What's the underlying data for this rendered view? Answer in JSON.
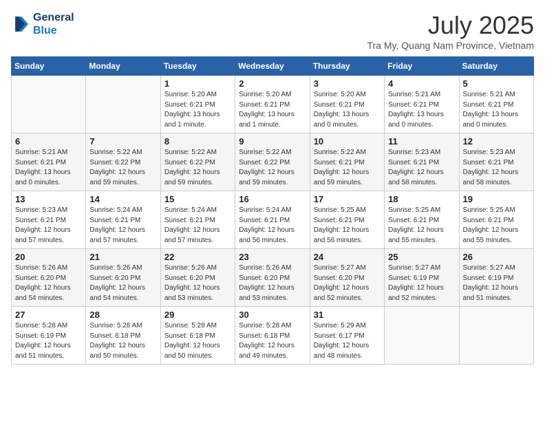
{
  "header": {
    "logo_line1": "General",
    "logo_line2": "Blue",
    "month_year": "July 2025",
    "location": "Tra My, Quang Nam Province, Vietnam"
  },
  "weekdays": [
    "Sunday",
    "Monday",
    "Tuesday",
    "Wednesday",
    "Thursday",
    "Friday",
    "Saturday"
  ],
  "weeks": [
    [
      {
        "day": "",
        "info": ""
      },
      {
        "day": "",
        "info": ""
      },
      {
        "day": "1",
        "info": "Sunrise: 5:20 AM\nSunset: 6:21 PM\nDaylight: 13 hours and 1 minute."
      },
      {
        "day": "2",
        "info": "Sunrise: 5:20 AM\nSunset: 6:21 PM\nDaylight: 13 hours and 1 minute."
      },
      {
        "day": "3",
        "info": "Sunrise: 5:20 AM\nSunset: 6:21 PM\nDaylight: 13 hours and 0 minutes."
      },
      {
        "day": "4",
        "info": "Sunrise: 5:21 AM\nSunset: 6:21 PM\nDaylight: 13 hours and 0 minutes."
      },
      {
        "day": "5",
        "info": "Sunrise: 5:21 AM\nSunset: 6:21 PM\nDaylight: 13 hours and 0 minutes."
      }
    ],
    [
      {
        "day": "6",
        "info": "Sunrise: 5:21 AM\nSunset: 6:21 PM\nDaylight: 13 hours and 0 minutes."
      },
      {
        "day": "7",
        "info": "Sunrise: 5:22 AM\nSunset: 6:22 PM\nDaylight: 12 hours and 59 minutes."
      },
      {
        "day": "8",
        "info": "Sunrise: 5:22 AM\nSunset: 6:22 PM\nDaylight: 12 hours and 59 minutes."
      },
      {
        "day": "9",
        "info": "Sunrise: 5:22 AM\nSunset: 6:22 PM\nDaylight: 12 hours and 59 minutes."
      },
      {
        "day": "10",
        "info": "Sunrise: 5:22 AM\nSunset: 6:21 PM\nDaylight: 12 hours and 59 minutes."
      },
      {
        "day": "11",
        "info": "Sunrise: 5:23 AM\nSunset: 6:21 PM\nDaylight: 12 hours and 58 minutes."
      },
      {
        "day": "12",
        "info": "Sunrise: 5:23 AM\nSunset: 6:21 PM\nDaylight: 12 hours and 58 minutes."
      }
    ],
    [
      {
        "day": "13",
        "info": "Sunrise: 5:23 AM\nSunset: 6:21 PM\nDaylight: 12 hours and 57 minutes."
      },
      {
        "day": "14",
        "info": "Sunrise: 5:24 AM\nSunset: 6:21 PM\nDaylight: 12 hours and 57 minutes."
      },
      {
        "day": "15",
        "info": "Sunrise: 5:24 AM\nSunset: 6:21 PM\nDaylight: 12 hours and 57 minutes."
      },
      {
        "day": "16",
        "info": "Sunrise: 5:24 AM\nSunset: 6:21 PM\nDaylight: 12 hours and 56 minutes."
      },
      {
        "day": "17",
        "info": "Sunrise: 5:25 AM\nSunset: 6:21 PM\nDaylight: 12 hours and 56 minutes."
      },
      {
        "day": "18",
        "info": "Sunrise: 5:25 AM\nSunset: 6:21 PM\nDaylight: 12 hours and 55 minutes."
      },
      {
        "day": "19",
        "info": "Sunrise: 5:25 AM\nSunset: 6:21 PM\nDaylight: 12 hours and 55 minutes."
      }
    ],
    [
      {
        "day": "20",
        "info": "Sunrise: 5:26 AM\nSunset: 6:20 PM\nDaylight: 12 hours and 54 minutes."
      },
      {
        "day": "21",
        "info": "Sunrise: 5:26 AM\nSunset: 6:20 PM\nDaylight: 12 hours and 54 minutes."
      },
      {
        "day": "22",
        "info": "Sunrise: 5:26 AM\nSunset: 6:20 PM\nDaylight: 12 hours and 53 minutes."
      },
      {
        "day": "23",
        "info": "Sunrise: 5:26 AM\nSunset: 6:20 PM\nDaylight: 12 hours and 53 minutes."
      },
      {
        "day": "24",
        "info": "Sunrise: 5:27 AM\nSunset: 6:20 PM\nDaylight: 12 hours and 52 minutes."
      },
      {
        "day": "25",
        "info": "Sunrise: 5:27 AM\nSunset: 6:19 PM\nDaylight: 12 hours and 52 minutes."
      },
      {
        "day": "26",
        "info": "Sunrise: 5:27 AM\nSunset: 6:19 PM\nDaylight: 12 hours and 51 minutes."
      }
    ],
    [
      {
        "day": "27",
        "info": "Sunrise: 5:28 AM\nSunset: 6:19 PM\nDaylight: 12 hours and 51 minutes."
      },
      {
        "day": "28",
        "info": "Sunrise: 5:28 AM\nSunset: 6:18 PM\nDaylight: 12 hours and 50 minutes."
      },
      {
        "day": "29",
        "info": "Sunrise: 5:28 AM\nSunset: 6:18 PM\nDaylight: 12 hours and 50 minutes."
      },
      {
        "day": "30",
        "info": "Sunrise: 5:28 AM\nSunset: 6:18 PM\nDaylight: 12 hours and 49 minutes."
      },
      {
        "day": "31",
        "info": "Sunrise: 5:29 AM\nSunset: 6:17 PM\nDaylight: 12 hours and 48 minutes."
      },
      {
        "day": "",
        "info": ""
      },
      {
        "day": "",
        "info": ""
      }
    ]
  ]
}
